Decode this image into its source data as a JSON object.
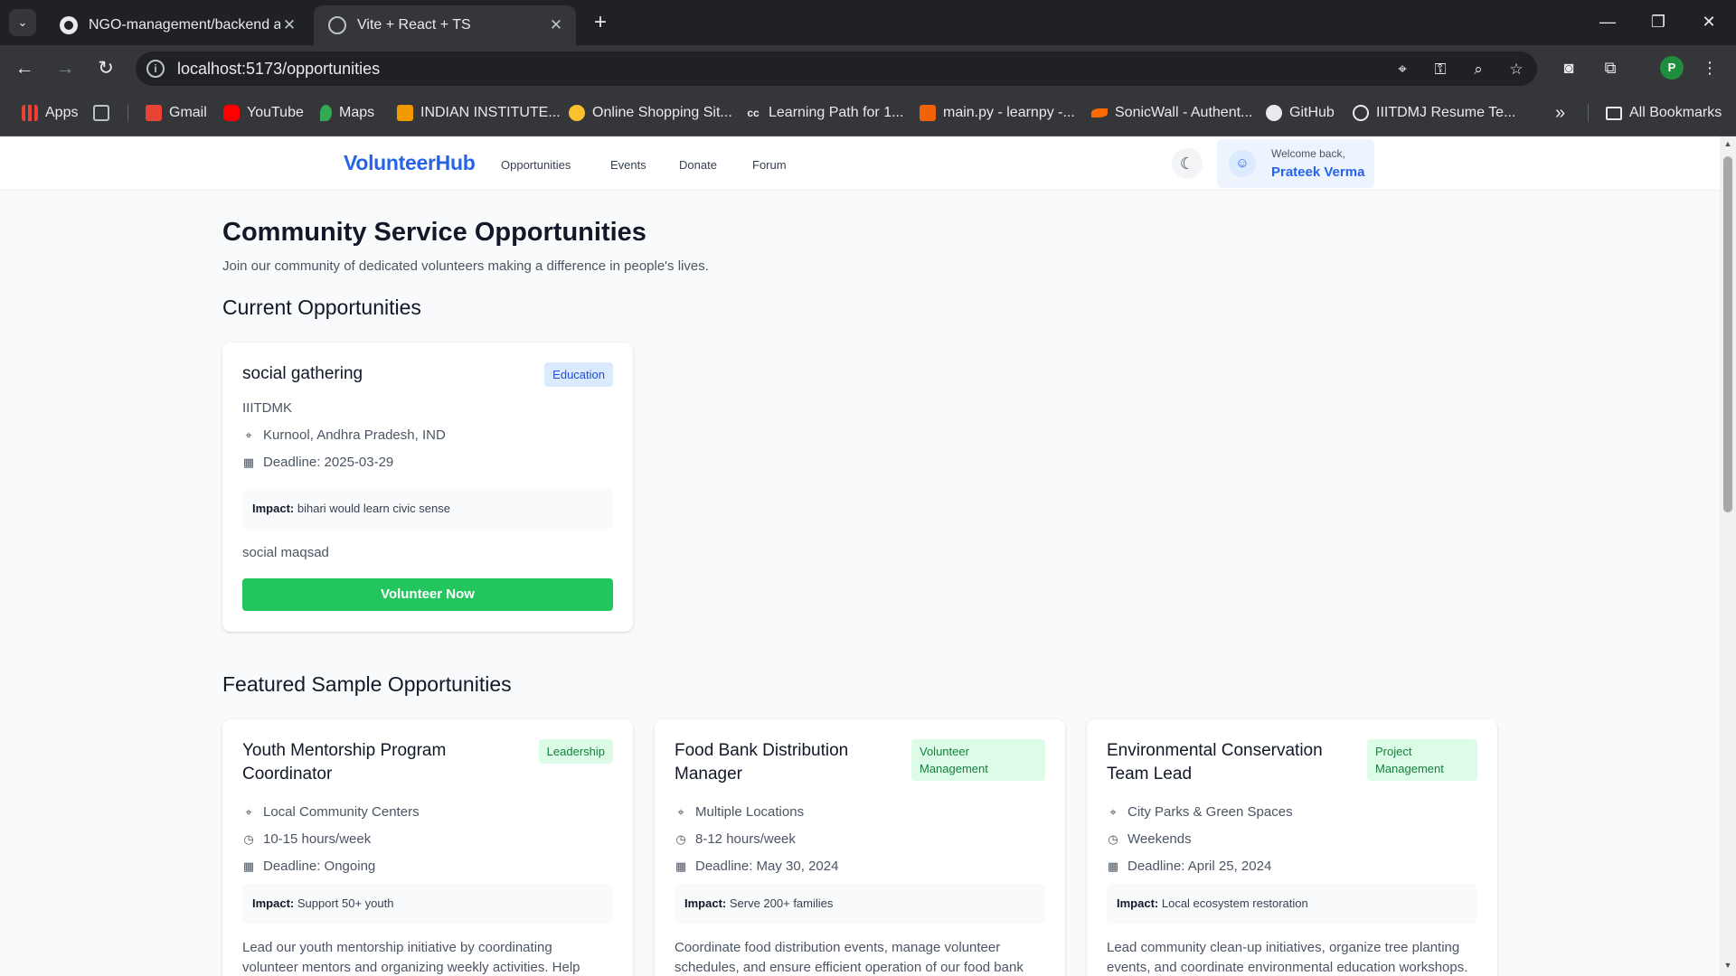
{
  "browser": {
    "tabs": [
      {
        "title": "NGO-management/backend at",
        "icon": "github-icon"
      },
      {
        "title": "Vite + React + TS",
        "icon": "globe-icon"
      }
    ],
    "url": "localhost:5173/opportunities",
    "bookmarks": [
      {
        "label": "Apps",
        "icon": "apps-grid-icon",
        "color": "#ea4335"
      },
      {
        "label": "Gmail",
        "icon": "gmail-icon",
        "color": "#ea4335"
      },
      {
        "label": "YouTube",
        "icon": "youtube-icon",
        "color": "#ff0000"
      },
      {
        "label": "Maps",
        "icon": "maps-icon",
        "color": "#34a853"
      },
      {
        "label": "INDIAN INSTITUTE...",
        "icon": "institute-icon",
        "color": "#f29900"
      },
      {
        "label": "Online Shopping Sit...",
        "icon": "flipkart-icon",
        "color": "#fbc02d"
      },
      {
        "label": "Learning Path for 1...",
        "icon": "cc-icon",
        "color": "#e8eaed"
      },
      {
        "label": "main.py - learnpy -...",
        "icon": "replit-icon",
        "color": "#f26207"
      },
      {
        "label": "SonicWall - Authent...",
        "icon": "sonicwall-icon",
        "color": "#ff6a00"
      },
      {
        "label": "GitHub",
        "icon": "github-icon",
        "color": "#e8eaed"
      },
      {
        "label": "IIITDMJ Resume Te...",
        "icon": "overleaf-icon",
        "color": "#e8eaed"
      }
    ],
    "all_bookmarks": "All Bookmarks"
  },
  "nav": {
    "brand": "VolunteerHub",
    "links": [
      "Opportunities",
      "Events",
      "Donate",
      "Forum"
    ],
    "welcome": "Welcome back,",
    "user": "Prateek Verma"
  },
  "hero": {
    "title": "Community Service Opportunities",
    "subtitle": "Join our community of dedicated volunteers making a difference in people's lives."
  },
  "current": {
    "heading": "Current Opportunities",
    "card": {
      "title": "social gathering",
      "tag": "Education",
      "org": "IIITDMK",
      "location": "Kurnool, Andhra Pradesh, IND",
      "deadline": "Deadline: 2025-03-29",
      "impact_label": "Impact:",
      "impact": "bihari would learn civic sense",
      "description": "social maqsad",
      "button": "Volunteer Now"
    }
  },
  "featured": {
    "heading": "Featured Sample Opportunities",
    "cards": [
      {
        "title_line1": "Youth Mentorship Program",
        "title_line2": "Coordinator",
        "tag_line1": "Leadership",
        "tag_line2": "",
        "location": "Local Community Centers",
        "hours": "10-15 hours/week",
        "deadline": "Deadline: Ongoing",
        "impact_label": "Impact:",
        "impact": "Support 50+ youth",
        "desc_line1": "Lead our youth mentorship initiative by coordinating",
        "desc_line2": "volunteer mentors and organizing weekly activities. Help"
      },
      {
        "title_line1": "Food Bank Distribution",
        "title_line2": "Manager",
        "tag_line1": "Volunteer",
        "tag_line2": "Management",
        "location": "Multiple Locations",
        "hours": "8-12 hours/week",
        "deadline": "Deadline: May 30, 2024",
        "impact_label": "Impact:",
        "impact": "Serve 200+ families",
        "desc_line1": "Coordinate food distribution events, manage volunteer",
        "desc_line2": "schedules, and ensure efficient operation of our food bank"
      },
      {
        "title_line1": "Environmental Conservation",
        "title_line2": "Team Lead",
        "tag_line1": "Project",
        "tag_line2": "Management",
        "location": "City Parks & Green Spaces",
        "hours": "Weekends",
        "deadline": "Deadline: April 25, 2024",
        "impact_label": "Impact:",
        "impact": "Local ecosystem restoration",
        "desc_line1": "Lead community clean-up initiatives, organize tree planting",
        "desc_line2": "events, and coordinate environmental education workshops."
      }
    ]
  },
  "colors": {
    "brand": "#2563eb",
    "button": "#22c55e",
    "tag_blue_bg": "#dbeafe",
    "tag_green_bg": "#dcfce7"
  }
}
